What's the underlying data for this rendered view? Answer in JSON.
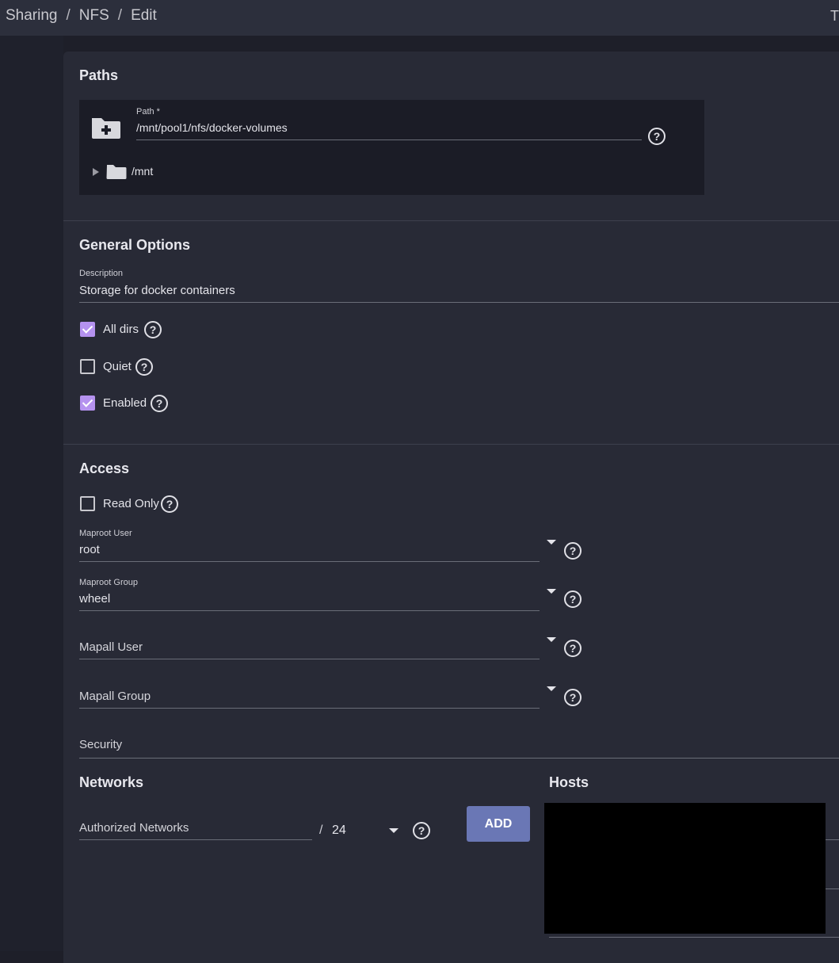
{
  "breadcrumb": {
    "items": [
      "Sharing",
      "NFS",
      "Edit"
    ],
    "separator": "/"
  },
  "header": {
    "corner_text": "T"
  },
  "paths": {
    "title": "Paths",
    "path_label": "Path *",
    "path_value": "/mnt/pool1/nfs/docker-volumes",
    "tree_root": "/mnt"
  },
  "general": {
    "title": "General Options",
    "description_label": "Description",
    "description_value": "Storage for docker containers",
    "checkboxes": [
      {
        "label": "All dirs",
        "checked": true
      },
      {
        "label": "Quiet",
        "checked": false
      },
      {
        "label": "Enabled",
        "checked": true
      }
    ]
  },
  "access": {
    "title": "Access",
    "read_only": {
      "label": "Read Only",
      "checked": false
    },
    "maproot_user": {
      "label": "Maproot User",
      "value": "root"
    },
    "maproot_group": {
      "label": "Maproot Group",
      "value": "wheel"
    },
    "mapall_user": {
      "placeholder": "Mapall User"
    },
    "mapall_group": {
      "placeholder": "Mapall Group"
    },
    "security": {
      "placeholder": "Security"
    }
  },
  "networks": {
    "title": "Networks",
    "authorized_placeholder": "Authorized Networks",
    "mask_separator": "/",
    "mask_value": "24",
    "add_label": "ADD"
  },
  "hosts": {
    "title": "Hosts"
  },
  "colors": {
    "accent": "#b592ef",
    "button": "#6a77b5",
    "card": "#282a36",
    "topbar": "#2c2f3c"
  },
  "icons": [
    "folder-add-icon",
    "expand-arrow-icon",
    "folder-icon",
    "help-icon",
    "check-icon",
    "dropdown-caret-icon"
  ]
}
